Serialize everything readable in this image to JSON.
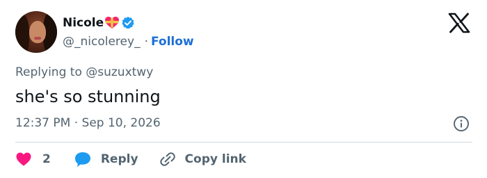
{
  "author": {
    "display_name": "Nicole",
    "name_emoji": "heart-with-ribbon-icon",
    "verified": true,
    "handle": "@_nicolerey_",
    "separator": "·",
    "follow_label": "Follow"
  },
  "reply_context": {
    "prefix": "Replying to",
    "mention": "@suzuxtwy"
  },
  "tweet": {
    "text": "she's so stunning",
    "timestamp": "12:37 PM · Sep 10, 2026"
  },
  "actions": {
    "like_count": "2",
    "reply_label": "Reply",
    "copy_link_label": "Copy link"
  },
  "colors": {
    "text_primary": "#0f1419",
    "text_secondary": "#536471",
    "follow_blue": "#1d6fd6",
    "verified_blue": "#1d9bf0",
    "like_pink": "#f91880",
    "divider": "#cfd9de"
  },
  "icons": {
    "brand": "x-logo-icon",
    "info": "info-icon",
    "like": "heart-icon",
    "reply": "reply-bubble-icon",
    "copy_link": "link-icon"
  }
}
